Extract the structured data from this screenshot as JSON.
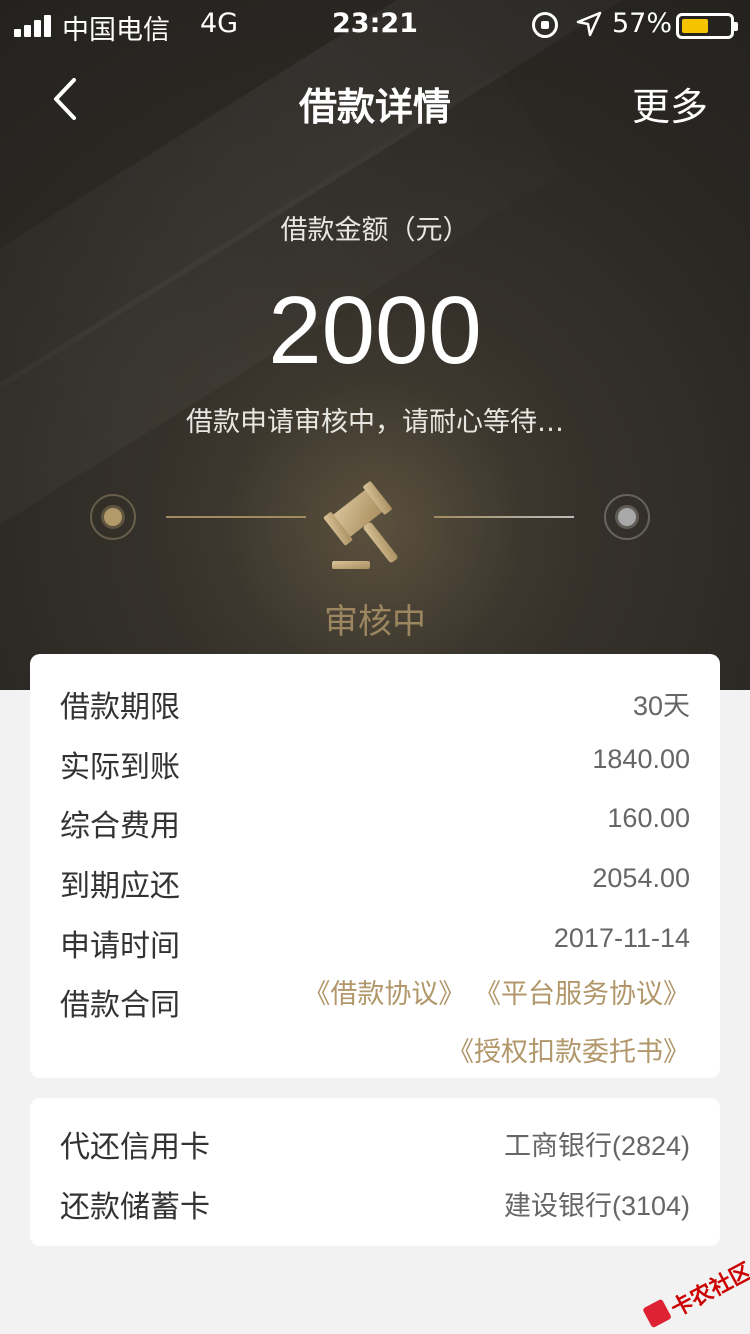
{
  "status_bar": {
    "carrier": "中国电信",
    "network": "4G",
    "time": "23:21",
    "battery_percent": "57%",
    "battery_level": 0.57
  },
  "nav": {
    "back_icon": "chevron-left-icon",
    "title": "借款详情",
    "more_label": "更多"
  },
  "loan": {
    "amount_label": "借款金额（元）",
    "amount": "2000",
    "status_text": "借款申请审核中，请耐心等待…",
    "stage_label": "审核中",
    "stage_icon": "gavel-icon"
  },
  "details": {
    "rows": [
      {
        "label": "借款期限",
        "value": "30天"
      },
      {
        "label": "实际到账",
        "value": "1840.00"
      },
      {
        "label": "综合费用",
        "value": "160.00"
      },
      {
        "label": "到期应还",
        "value": "2054.00"
      },
      {
        "label": "申请时间",
        "value": "2017-11-14"
      }
    ],
    "contract_label": "借款合同",
    "contracts": [
      "《借款协议》",
      "《平台服务协议》",
      "《授权扣款委托书》"
    ]
  },
  "cards": {
    "rows": [
      {
        "label": "代还信用卡",
        "value": "工商银行(2824)"
      },
      {
        "label": "还款储蓄卡",
        "value": "建设银行(3104)"
      }
    ]
  },
  "watermark": {
    "text": "卡农社区"
  },
  "colors": {
    "accent_gold": "#b1976a",
    "header_dark": "#2a2723",
    "battery_yellow": "#f5c400"
  }
}
